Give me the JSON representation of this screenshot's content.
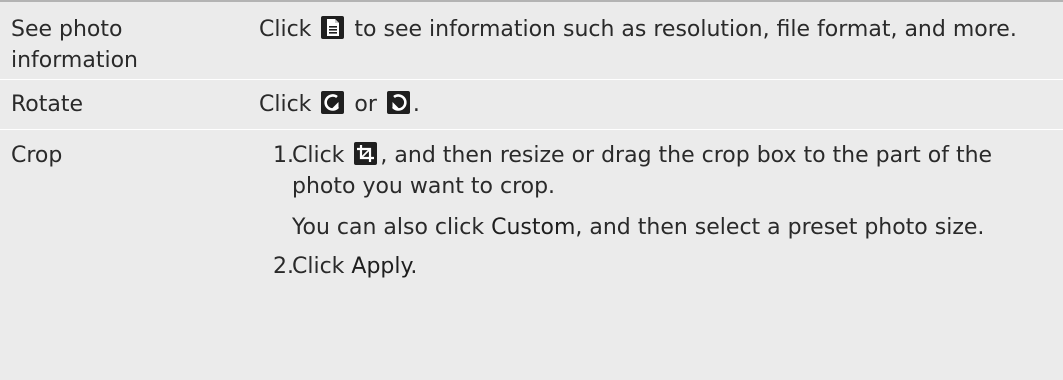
{
  "rows": [
    {
      "action": "See photo information",
      "before_icon": "Click ",
      "icon": "document-details-icon",
      "after_icon": " to see information such as resolution, file format, and more."
    },
    {
      "action": "Rotate",
      "before_icon": "Click ",
      "icon_left": "rotate-left-icon",
      "middle": " or ",
      "icon_right": "rotate-right-icon",
      "after": "."
    },
    {
      "action": "Crop",
      "steps": [
        {
          "number": "1.",
          "before_icon": "Click ",
          "icon": "crop-icon",
          "after_icon": ", and then resize or drag the crop box to the part of the photo you want to crop.",
          "extra_before": "You can also click ",
          "extra_emph": "Custom",
          "extra_after": ", and then select a preset photo size."
        },
        {
          "number": "2.",
          "before": "Click ",
          "emph": "Apply",
          "after": "."
        }
      ]
    }
  ],
  "colors": {
    "table_bg": "#ebebeb",
    "top_rule": "#b3b3b3",
    "text": "#2a2a2a",
    "icon_bg": "#1f1f1f"
  }
}
